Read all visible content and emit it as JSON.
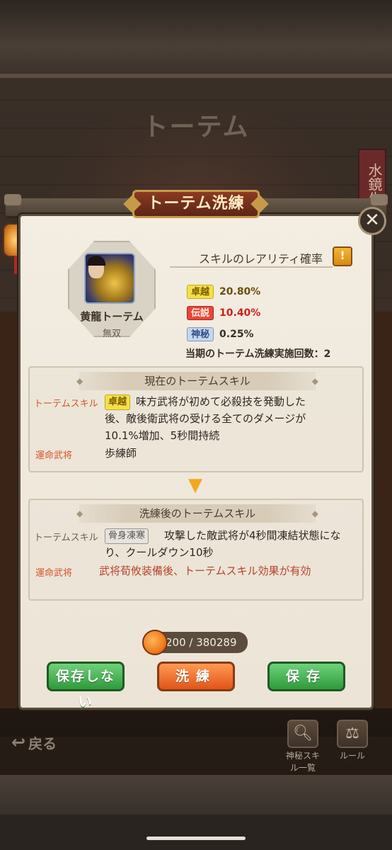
{
  "background": {
    "title": "トーテム",
    "banner_text": "水鏡先"
  },
  "modal": {
    "title": "トーテム洗練",
    "close_icon": "✕"
  },
  "totem": {
    "name": "黄龍トーテム",
    "subtitle": "無双"
  },
  "rarity": {
    "heading": "スキルのレアリティ確率",
    "info_icon": "!",
    "rows": [
      {
        "tag": "卓越",
        "value": "20.80%"
      },
      {
        "tag": "伝説",
        "value": "10.40%"
      },
      {
        "tag": "神秘",
        "value": "0.25%"
      }
    ],
    "count_text": "当期のトーテム洗練実施回数：2"
  },
  "current_skill": {
    "heading": "現在のトーテムスキル",
    "skill_label": "トーテムスキル",
    "skill_tag": "卓越",
    "description_line1": "味方武将が初めて必殺技を発動した",
    "description_line2": "後、敵後衛武将の受ける全てのダメージが",
    "description_line3": "10.1%増加、5秒間持続",
    "fate_label": "運命武将",
    "fate_value": "歩練師"
  },
  "after_skill": {
    "heading": "洗練後のトーテムスキル",
    "skill_label": "トーテムスキル",
    "skill_tag": "骨身凍寒",
    "description_line1": "攻撃した敵武将が4秒間凍結状態にな",
    "description_line2": "り、クールダウン10秒",
    "fate_label": "運命武将",
    "fate_value": "武将荀攸装備後、トーテムスキル効果が有効"
  },
  "cost": {
    "text": "200 / 380289"
  },
  "buttons": {
    "no_save": "保存しない",
    "refine": "洗練",
    "save": "保存"
  },
  "footer": {
    "back_label": "戻る",
    "mystic_list_label": "神秘スキル一覧",
    "rules_label": "ルール"
  },
  "colors": {
    "accent_gold": "#f4e04a",
    "accent_red": "#e9463a",
    "accent_blue": "#c8d6ec",
    "button_green": "#2f9a3c",
    "button_orange": "#e0541a"
  }
}
